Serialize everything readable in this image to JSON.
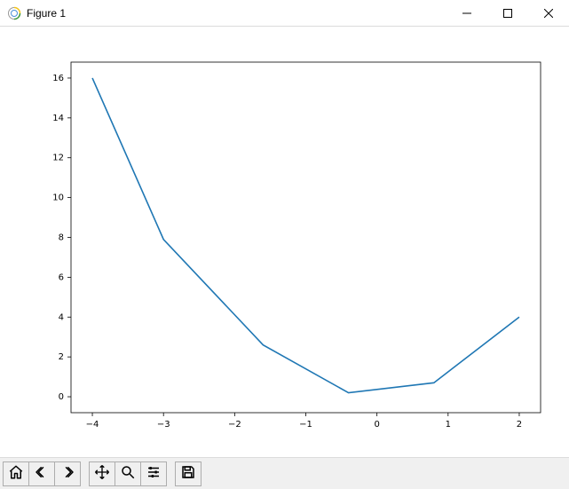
{
  "window": {
    "title": "Figure 1"
  },
  "toolbar": {
    "home_label": "Home",
    "back_label": "Back",
    "forward_label": "Forward",
    "pan_label": "Pan",
    "zoom_label": "Zoom",
    "configure_label": "Configure subplots",
    "save_label": "Save"
  },
  "chart_data": {
    "type": "line",
    "x": [
      -4,
      -3,
      -1.6,
      -0.4,
      0.8,
      2
    ],
    "y": [
      16,
      7.9,
      2.6,
      0.2,
      0.7,
      4
    ],
    "title": "",
    "xlabel": "",
    "ylabel": "",
    "xticks": [
      -4,
      -3,
      -2,
      -1,
      0,
      1,
      2
    ],
    "yticks": [
      0,
      2,
      4,
      6,
      8,
      10,
      12,
      14,
      16
    ],
    "xlim": [
      -4.3,
      2.3
    ],
    "ylim": [
      -0.8,
      16.8
    ],
    "line_color": "#1f77b4"
  }
}
